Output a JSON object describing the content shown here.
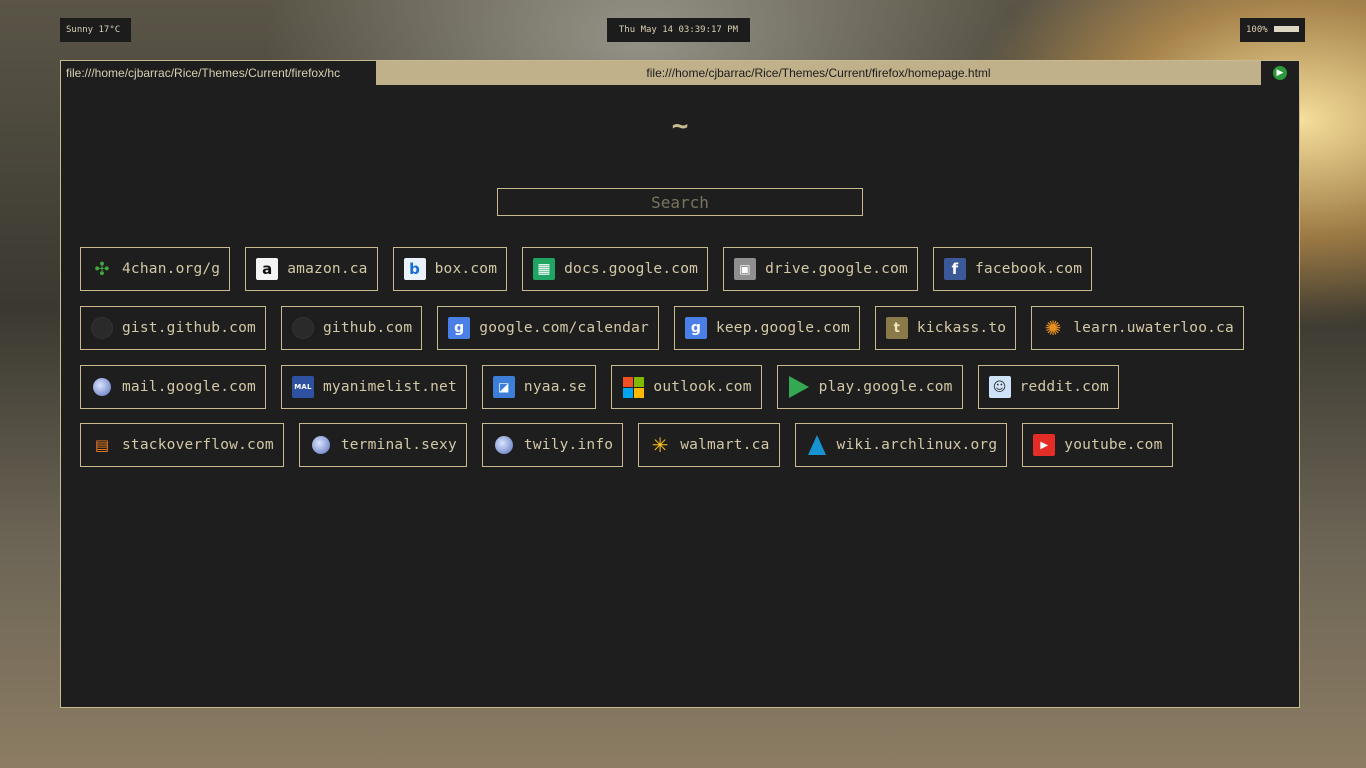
{
  "statusbar": {
    "weather": "Sunny 17°C",
    "clock": "Thu May 14 03:39:17 PM",
    "battery": "100%"
  },
  "browser": {
    "tab_title": "file:///home/cjbarrac/Rice/Themes/Current/firefox/hc",
    "url": "file:///home/cjbarrac/Rice/Themes/Current/firefox/homepage.html"
  },
  "page": {
    "heading": "~",
    "search_placeholder": "Search"
  },
  "links": [
    [
      {
        "label": "4chan.org/g",
        "icon": "4chan-clover-icon"
      },
      {
        "label": "amazon.ca",
        "icon": "amazon-icon"
      },
      {
        "label": "box.com",
        "icon": "box-icon"
      },
      {
        "label": "docs.google.com",
        "icon": "google-sheets-icon"
      },
      {
        "label": "drive.google.com",
        "icon": "google-drive-icon"
      },
      {
        "label": "facebook.com",
        "icon": "facebook-icon"
      }
    ],
    [
      {
        "label": "gist.github.com",
        "icon": "github-icon"
      },
      {
        "label": "github.com",
        "icon": "github-icon"
      },
      {
        "label": "google.com/calendar",
        "icon": "google-icon"
      },
      {
        "label": "keep.google.com",
        "icon": "google-icon"
      },
      {
        "label": "kickass.to",
        "icon": "kickass-shield-icon"
      },
      {
        "label": "learn.uwaterloo.ca",
        "icon": "uwaterloo-icon"
      }
    ],
    [
      {
        "label": "mail.google.com",
        "icon": "globe-icon"
      },
      {
        "label": "myanimelist.net",
        "icon": "myanimelist-icon"
      },
      {
        "label": "nyaa.se",
        "icon": "nyaa-icon"
      },
      {
        "label": "outlook.com",
        "icon": "microsoft-icon"
      },
      {
        "label": "play.google.com",
        "icon": "google-play-icon"
      },
      {
        "label": "reddit.com",
        "icon": "reddit-icon"
      }
    ],
    [
      {
        "label": "stackoverflow.com",
        "icon": "stackoverflow-icon"
      },
      {
        "label": "terminal.sexy",
        "icon": "globe-icon"
      },
      {
        "label": "twily.info",
        "icon": "globe-icon"
      },
      {
        "label": "walmart.ca",
        "icon": "walmart-spark-icon"
      },
      {
        "label": "wiki.archlinux.org",
        "icon": "archlinux-icon"
      },
      {
        "label": "youtube.com",
        "icon": "youtube-icon"
      }
    ]
  ],
  "colors": {
    "window_bg": "#1e1e1e",
    "accent": "#c8b98f",
    "text": "#d3c8a6",
    "titlebar": "#c0b18b"
  }
}
